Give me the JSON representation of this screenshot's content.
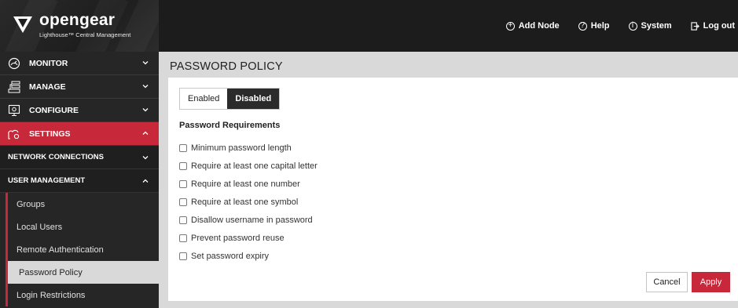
{
  "brand": {
    "name": "opengear",
    "subtitle": "Lighthouse™ Central Management"
  },
  "top_nav": [
    {
      "label": "Add Node",
      "icon": "plus-circle-icon"
    },
    {
      "label": "Help",
      "icon": "question-circle-icon"
    },
    {
      "label": "System",
      "icon": "info-circle-icon"
    },
    {
      "label": "Log out",
      "icon": "logout-icon"
    }
  ],
  "sidebar": {
    "main": [
      {
        "label": "MONITOR",
        "icon": "gauge-icon"
      },
      {
        "label": "MANAGE",
        "icon": "server-stack-icon"
      },
      {
        "label": "CONFIGURE",
        "icon": "monitor-gear-icon"
      },
      {
        "label": "SETTINGS",
        "icon": "cloud-settings-icon"
      }
    ],
    "sub": [
      {
        "label": "NETWORK CONNECTIONS"
      },
      {
        "label": "USER MANAGEMENT"
      }
    ],
    "leaves": [
      "Groups",
      "Local Users",
      "Remote Authentication",
      "Password Policy",
      "Login Restrictions"
    ]
  },
  "page": {
    "title": "PASSWORD POLICY",
    "toggle": {
      "enabled": "Enabled",
      "disabled": "Disabled",
      "selected": "Disabled"
    },
    "section_heading": "Password Requirements",
    "checkboxes": [
      "Minimum password length",
      "Require at least one capital letter",
      "Require at least one number",
      "Require at least one symbol",
      "Disallow username in password",
      "Prevent password reuse",
      "Set password expiry"
    ],
    "cancel_label": "Cancel",
    "apply_label": "Apply"
  },
  "colors": {
    "accent": "#c8293a",
    "header_bg": "#1c1c1c",
    "sidebar_bg": "#262626"
  }
}
